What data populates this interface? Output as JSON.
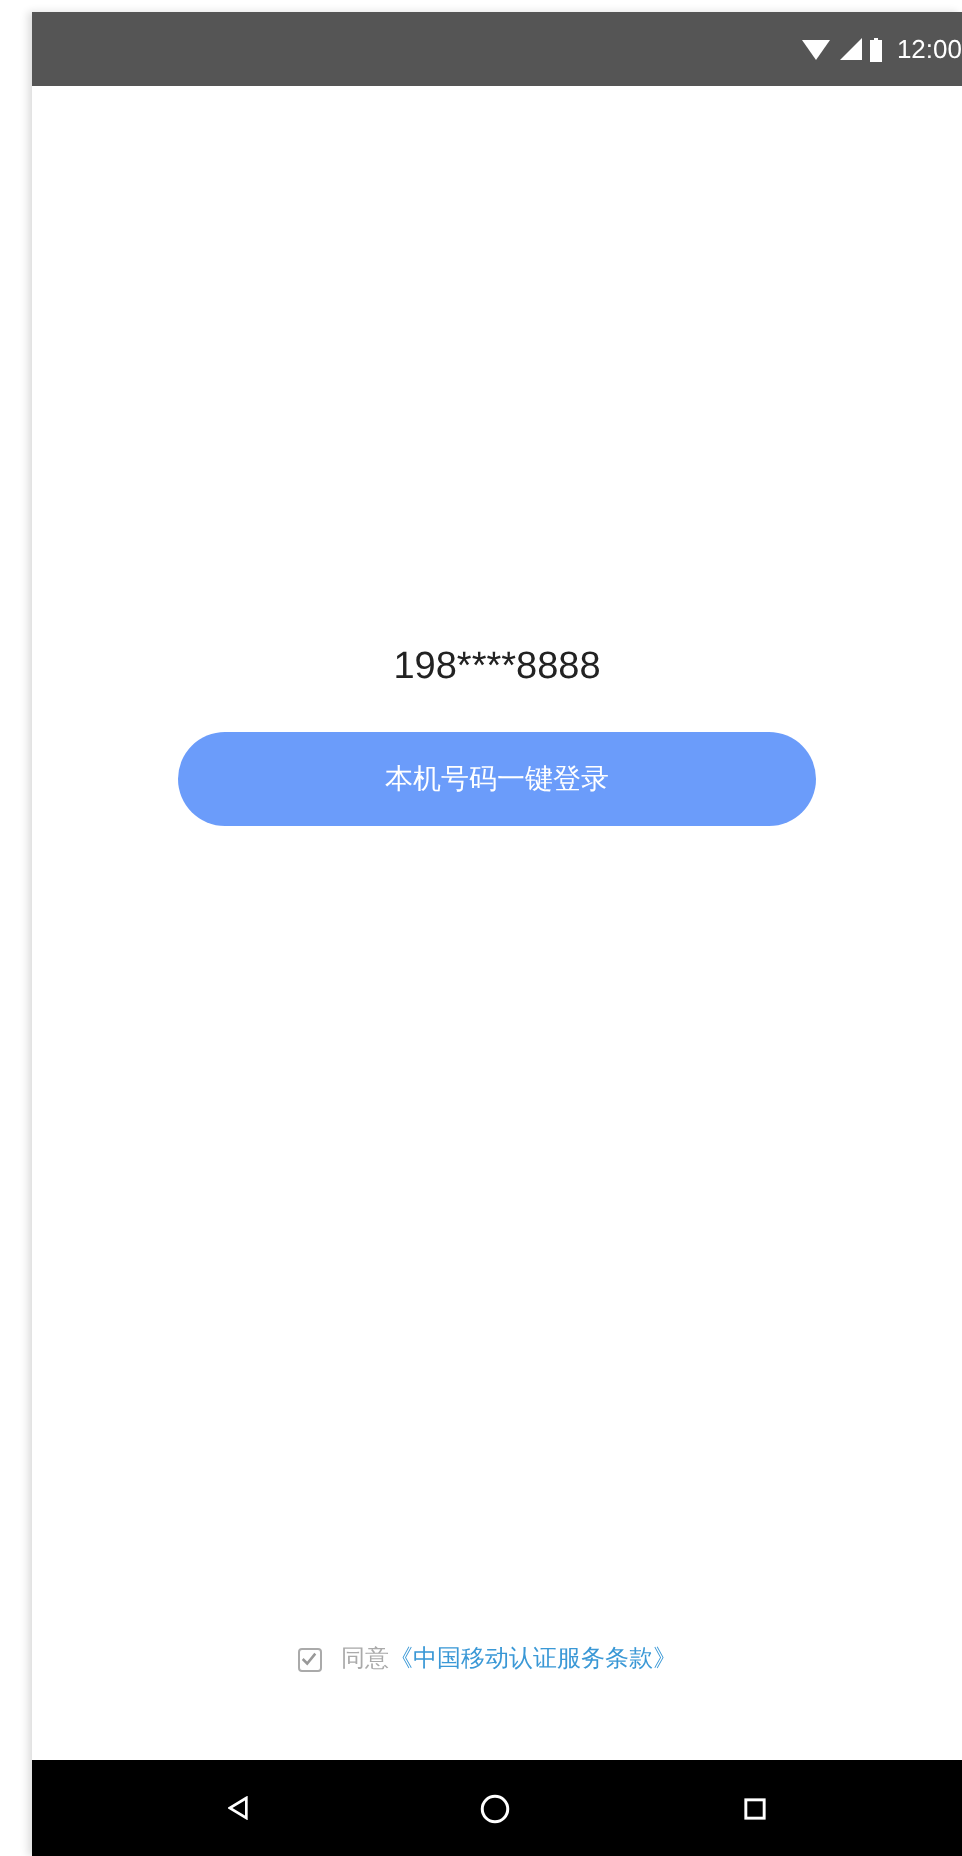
{
  "status_bar": {
    "time": "12:00"
  },
  "phone_number": "198****8888",
  "login_button": {
    "label": "本机号码一键登录"
  },
  "agreement": {
    "checked": true,
    "prefix": "同意",
    "link": "《中国移动认证服务条款》"
  }
}
